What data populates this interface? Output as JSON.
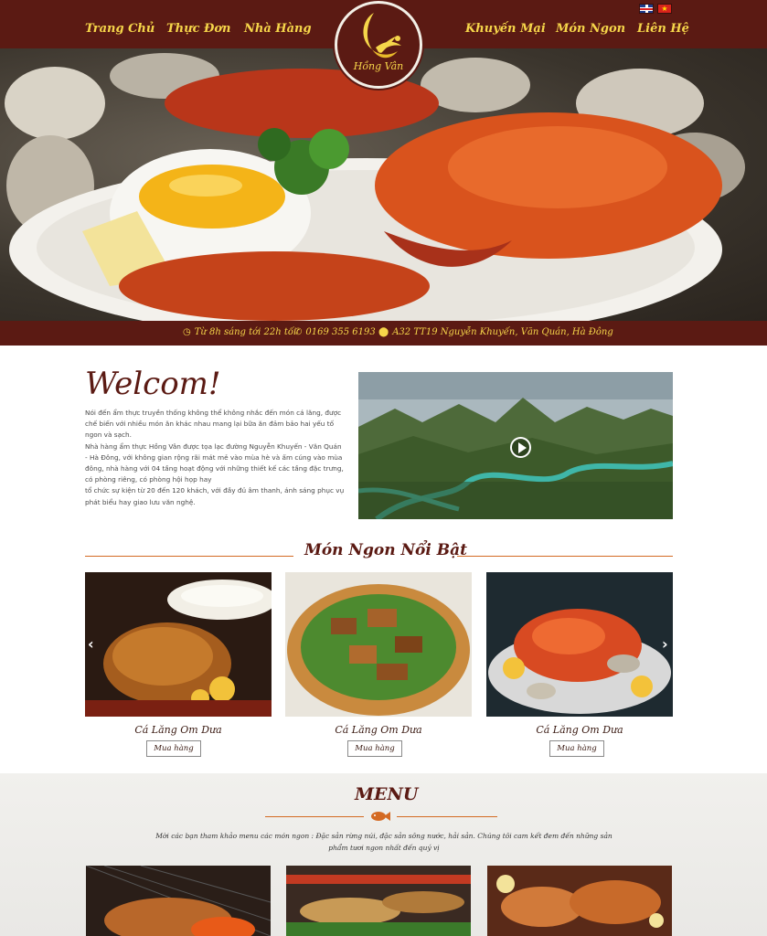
{
  "header": {
    "nav_left": [
      "Trang Chủ",
      "Thực Đơn",
      "Nhà Hàng"
    ],
    "nav_right": [
      "Khuyến Mại",
      "Món Ngon",
      "Liên Hệ"
    ],
    "logo_text": "Hồng Vân",
    "languages": [
      "English",
      "Tiếng Việt"
    ]
  },
  "infobar": {
    "hours": "Từ 8h sáng tới 22h tối",
    "phone": "0169 355 6193",
    "address": "A32 TT19 Nguyễn Khuyến, Văn Quán, Hà Đông"
  },
  "welcome": {
    "title": "Welcom!",
    "paragraphs": [
      "Nói đến ẩm thực truyền thống không thể không nhắc đến món cá lăng, được chế biến với nhiều món ăn khác nhau mang lại bữa ăn đảm bảo hai yếu tố ngon và sạch.",
      "Nhà hàng ẩm thực Hồng Vân được tọa lạc đường Nguyễn Khuyến - Văn Quán - Hà Đông, với không gian rộng rãi mát mẻ vào mùa hè và ấm cúng vào mùa đông, nhà hàng với 04 tầng hoạt động với những thiết kế các tầng đặc trưng, có phòng riêng, có phòng hội họp hay",
      "tổ chức sự kiện từ 20 đến 120 khách, với đầy đủ âm thanh, ánh sáng phục vụ phát biểu hay giao lưu văn nghệ."
    ]
  },
  "featured": {
    "title": "Món Ngon Nổi Bật",
    "items": [
      {
        "name": "Cá Lăng Om Dưa",
        "button": "Mua hàng"
      },
      {
        "name": "Cá Lăng Om Dưa",
        "button": "Mua hàng"
      },
      {
        "name": "Cá Lăng Om Dưa",
        "button": "Mua hàng"
      }
    ]
  },
  "menu": {
    "title": "MENU",
    "description": "Mời các bạn tham khảo menu các món ngon : Đặc sản rừng núi, đặc sản sông nước, hải sản. Chúng tôi cam kết đem đến những sản phẩm tươi ngon nhất đến quý vị"
  },
  "colors": {
    "brand": "#5b1a13",
    "accent": "#f6d64a",
    "rule": "#d46a23"
  },
  "icons": {
    "hours": "clock-icon",
    "phone": "phone-icon",
    "address": "map-pin-icon",
    "prev": "chevron-left-icon",
    "next": "chevron-right-icon",
    "video": "play-icon",
    "divider": "fish-icon"
  }
}
